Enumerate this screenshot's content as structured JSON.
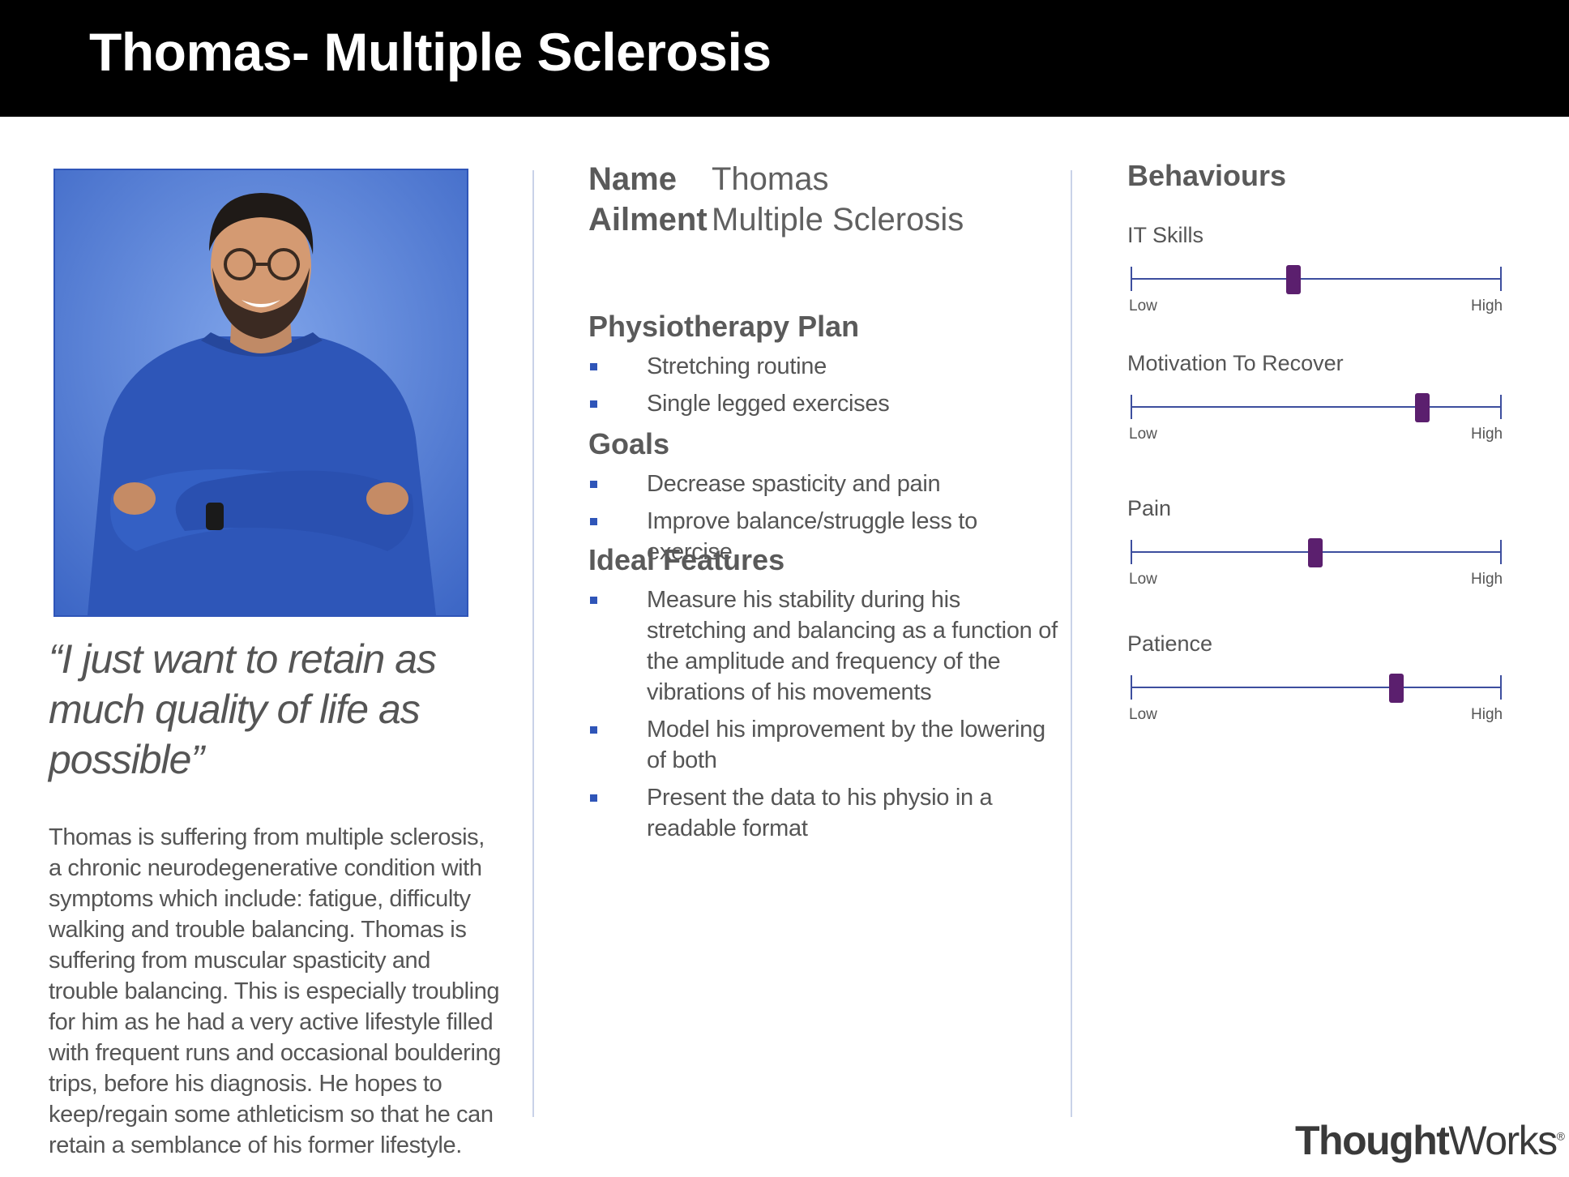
{
  "header": {
    "title": "Thomas- Multiple Sclerosis"
  },
  "quote": "“I just want to retain as much quality of life as possible”",
  "bio": "Thomas is suffering from multiple sclerosis, a chronic neurodegenerative condition with symptoms which include: fatigue, difficulty walking and trouble balancing. Thomas is suffering from muscular spasticity and trouble balancing. This is especially troubling for him as he had a very active lifestyle filled with frequent runs and occasional bouldering trips, before his diagnosis. He hopes to keep/regain some athleticism so that he can retain a semblance of his former lifestyle.",
  "profile": {
    "name_label": "Name",
    "name_value": "Thomas",
    "ailment_label": "Ailment",
    "ailment_value": "Multiple Sclerosis"
  },
  "physio": {
    "title": "Physiotherapy Plan",
    "items": [
      "Stretching routine",
      "Single legged exercises"
    ]
  },
  "goals": {
    "title": "Goals",
    "items": [
      "Decrease spasticity and pain",
      "Improve balance/struggle less to exercise"
    ]
  },
  "features": {
    "title": "Ideal Features",
    "items": [
      "Measure his stability during his stretching and balancing as a function of the amplitude and frequency of the vibrations of his movements",
      "Model his improvement by the lowering of both",
      "Present the data to his physio in a readable format"
    ]
  },
  "behaviours": {
    "title": "Behaviours",
    "low_label": "Low",
    "high_label": "High",
    "sliders": [
      {
        "label": "IT Skills",
        "level": 0.44
      },
      {
        "label": "Motivation To Recover",
        "level": 0.79
      },
      {
        "label": "Pain",
        "level": 0.5
      },
      {
        "label": "Patience",
        "level": 0.72
      }
    ]
  },
  "logo": {
    "bold": "Thought",
    "regular": "Works",
    "mark": "®"
  },
  "colors": {
    "accent": "#2f55b8",
    "knob": "#5b1f6e",
    "track": "#3d4e9e",
    "header_bg": "#000000"
  }
}
